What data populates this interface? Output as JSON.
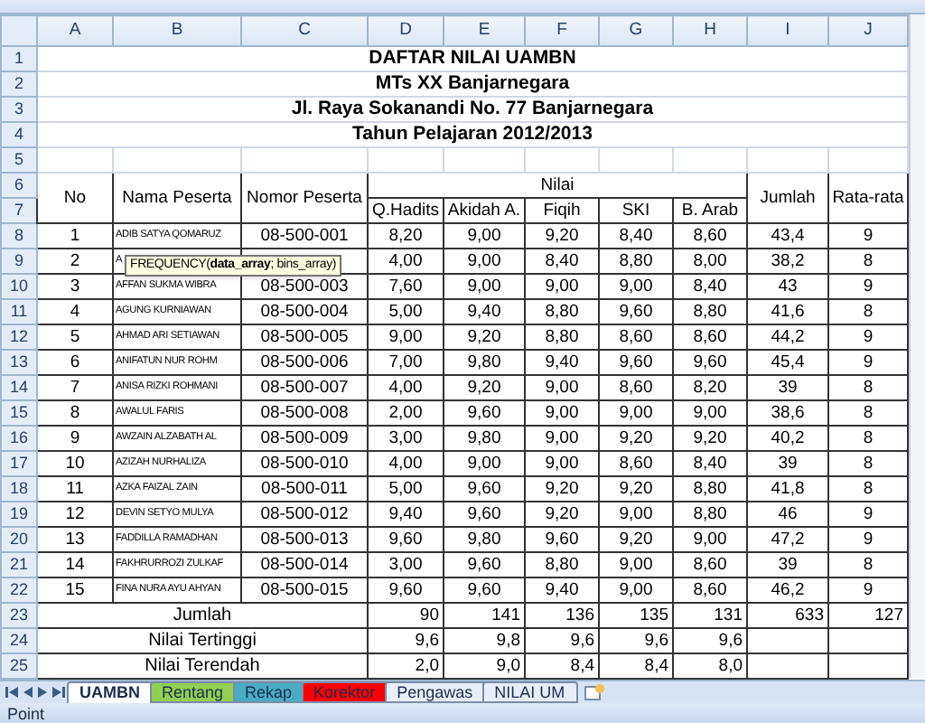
{
  "columns": [
    "A",
    "B",
    "C",
    "D",
    "E",
    "F",
    "G",
    "H",
    "I",
    "J"
  ],
  "row_numbers": [
    "1",
    "2",
    "3",
    "4",
    "5",
    "6",
    "7",
    "8",
    "9",
    "10",
    "11",
    "12",
    "13",
    "14",
    "15",
    "16",
    "17",
    "18",
    "19",
    "20",
    "21",
    "22",
    "23",
    "24",
    "25"
  ],
  "title_lines": [
    "DAFTAR NILAI UAMBN",
    "MTs XX  Banjarnegara",
    "Jl. Raya Sokanandi No. 77 Banjarnegara",
    "Tahun Pelajaran 2012/2013"
  ],
  "header": {
    "no": "No",
    "name": "Nama Peserta",
    "number": "Nomor Peserta",
    "nilai": "Nilai",
    "subjects": [
      "Q.Hadits",
      "Akidah A.",
      "Fiqih",
      "SKI",
      "B. Arab"
    ],
    "jumlah": "Jumlah",
    "average": "Rata-rata"
  },
  "students": [
    {
      "no": "1",
      "name": "ADIB SATYA QOMARUZ",
      "number": "08-500-001",
      "scores": [
        "8,20",
        "9,00",
        "9,20",
        "8,40",
        "8,60"
      ],
      "jumlah": "43,4",
      "average": "9"
    },
    {
      "no": "2",
      "name": "A",
      "scores": [
        "4,00",
        "9,00",
        "8,40",
        "8,80",
        "8,00"
      ],
      "jumlah": "38,2",
      "average": "8"
    },
    {
      "no": "3",
      "name": "AFFAN SUKMA WIBRA",
      "number": "08-500-003",
      "scores": [
        "7,60",
        "9,00",
        "9,00",
        "9,00",
        "8,40"
      ],
      "jumlah": "43",
      "average": "9"
    },
    {
      "no": "4",
      "name": "AGUNG KURNIAWAN",
      "number": "08-500-004",
      "scores": [
        "5,00",
        "9,40",
        "8,80",
        "9,60",
        "8,80"
      ],
      "jumlah": "41,6",
      "average": "8"
    },
    {
      "no": "5",
      "name": "AHMAD ARI SETIAWAN",
      "number": "08-500-005",
      "scores": [
        "9,00",
        "9,20",
        "8,80",
        "8,60",
        "8,60"
      ],
      "jumlah": "44,2",
      "average": "9"
    },
    {
      "no": "6",
      "name": "ANIFATUN NUR ROHM",
      "number": "08-500-006",
      "scores": [
        "7,00",
        "9,80",
        "9,40",
        "9,60",
        "9,60"
      ],
      "jumlah": "45,4",
      "average": "9"
    },
    {
      "no": "7",
      "name": "ANISA RIZKI ROHMANI",
      "number": "08-500-007",
      "scores": [
        "4,00",
        "9,20",
        "9,00",
        "8,60",
        "8,20"
      ],
      "jumlah": "39",
      "average": "8"
    },
    {
      "no": "8",
      "name": "AWALUL FARIS",
      "number": "08-500-008",
      "scores": [
        "2,00",
        "9,60",
        "9,00",
        "9,00",
        "9,00"
      ],
      "jumlah": "38,6",
      "average": "8"
    },
    {
      "no": "9",
      "name": "AWZAIN ALZABATH AL",
      "number": "08-500-009",
      "scores": [
        "3,00",
        "9,80",
        "9,00",
        "9,20",
        "9,20"
      ],
      "jumlah": "40,2",
      "average": "8"
    },
    {
      "no": "10",
      "name": "AZIZAH NURHALIZA",
      "number": "08-500-010",
      "scores": [
        "4,00",
        "9,00",
        "9,00",
        "8,60",
        "8,40"
      ],
      "jumlah": "39",
      "average": "8"
    },
    {
      "no": "11",
      "name": "AZKA FAIZAL ZAIN",
      "number": "08-500-011",
      "scores": [
        "5,00",
        "9,60",
        "9,20",
        "9,20",
        "8,80"
      ],
      "jumlah": "41,8",
      "average": "8"
    },
    {
      "no": "12",
      "name": "DEVIN SETYO MULYA",
      "number": "08-500-012",
      "scores": [
        "9,40",
        "9,60",
        "9,20",
        "9,00",
        "8,80"
      ],
      "jumlah": "46",
      "average": "9"
    },
    {
      "no": "13",
      "name": "FADDILLA RAMADHAN",
      "number": "08-500-013",
      "scores": [
        "9,60",
        "9,80",
        "9,60",
        "9,20",
        "9,00"
      ],
      "jumlah": "47,2",
      "average": "9"
    },
    {
      "no": "14",
      "name": "FAKHRURROZI ZULKAF",
      "number": "08-500-014",
      "scores": [
        "3,00",
        "9,60",
        "8,80",
        "9,00",
        "8,60"
      ],
      "jumlah": "39",
      "average": "8"
    },
    {
      "no": "15",
      "name": "FINA NURA AYU AHYAN",
      "number": "08-500-015",
      "scores": [
        "9,60",
        "9,60",
        "9,40",
        "9,00",
        "8,60"
      ],
      "jumlah": "46,2",
      "average": "9"
    }
  ],
  "summary": [
    {
      "label": "Jumlah",
      "values": [
        "90",
        "141",
        "136",
        "135",
        "131",
        "633",
        "127"
      ]
    },
    {
      "label": "Nilai Tertinggi",
      "values": [
        "9,6",
        "9,8",
        "9,6",
        "9,6",
        "9,6"
      ]
    },
    {
      "label": "Nilai Terendah",
      "values": [
        "2,0",
        "9,0",
        "8,4",
        "8,4",
        "8,0"
      ]
    }
  ],
  "tooltip": "FREQUENCY(**data_array**; bins_array)",
  "sheet_tabs": [
    {
      "label": "UAMBN",
      "selected": true
    },
    {
      "label": "Rentang",
      "selected": false,
      "color": "#92d050"
    },
    {
      "label": "Rekap",
      "selected": false,
      "color": "#4bacc6"
    },
    {
      "label": "Korektor",
      "selected": false,
      "color": "#ff0000"
    },
    {
      "label": "Pengawas",
      "selected": false
    },
    {
      "label": "NILAI UM",
      "selected": false
    }
  ],
  "status_bar": "Point"
}
